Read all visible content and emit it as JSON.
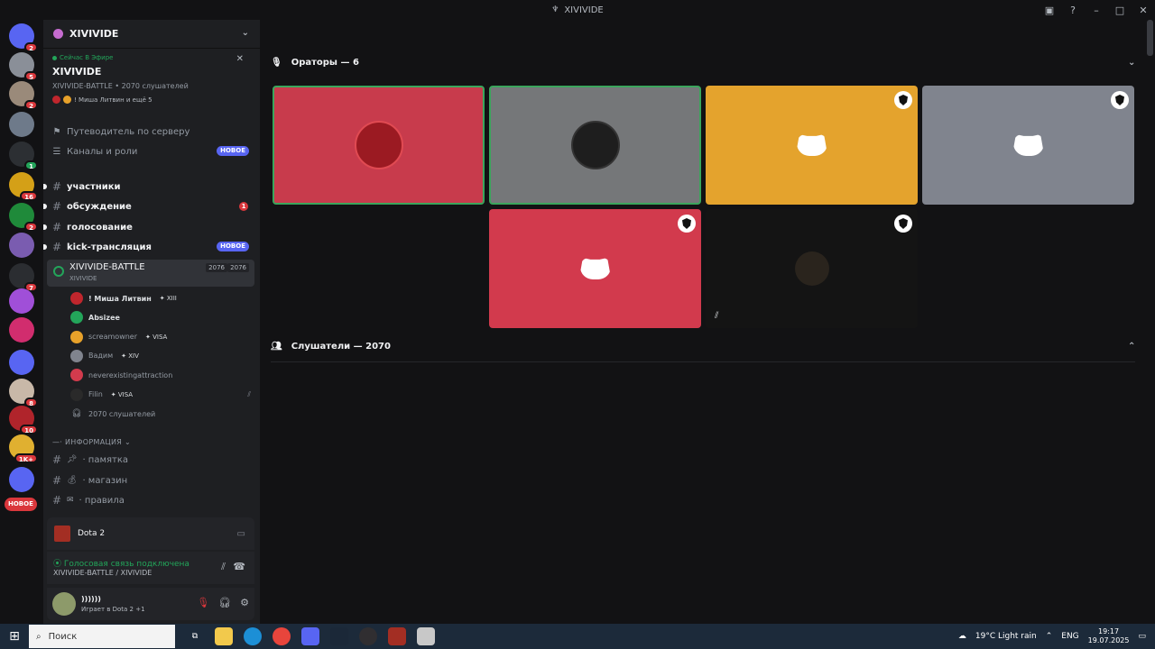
{
  "window": {
    "title": "XIVIVIDE"
  },
  "guilds": {
    "badges": [
      "2",
      "5",
      "2",
      "",
      "1",
      "16",
      "2",
      "",
      "7",
      "",
      "",
      "",
      "8",
      "10",
      "1K+",
      ""
    ],
    "new_label": "НОВОЕ"
  },
  "server": {
    "name": "XIVIVIDE"
  },
  "live": {
    "tag": "Сейчас В Эфире",
    "name": "XIVIVIDE",
    "meta": "XIVIVIDE-BATTLE • 2070 слушателей",
    "who": "! Миша Литвин и ещё 5"
  },
  "nav": {
    "guide": "Путеводитель по серверу",
    "channels_roles": "Каналы и роли",
    "new_badge": "НОВОЕ"
  },
  "channels": [
    {
      "name": "участники",
      "badge": ""
    },
    {
      "name": "обсуждение",
      "badge": "1"
    },
    {
      "name": "голосование",
      "badge": ""
    },
    {
      "name": "kick-трансляция",
      "badge": "НОВОЕ"
    }
  ],
  "voice_channel": {
    "name": "XIVIVIDE-BATTLE",
    "sub": "XIVIVIDE",
    "count1": "2076",
    "count2": "2076"
  },
  "voice_users": [
    {
      "name": "! Миша Литвин",
      "tag": "XIII",
      "color": "#c0262d"
    },
    {
      "name": "Absizee",
      "tag": "",
      "color": "#23a55a"
    },
    {
      "name": "screamowner",
      "tag": "VISA",
      "color": "#e7a12a"
    },
    {
      "name": "Вадим",
      "tag": "XIV",
      "color": "#80848e"
    },
    {
      "name": "neverexistingattraction",
      "tag": "",
      "color": "#d23b4d"
    },
    {
      "name": "Filin",
      "tag": "VISA",
      "color": "#2a2a2a"
    }
  ],
  "listeners_text": "2070 слушателей",
  "category": "ИНФОРМАЦИЯ",
  "info_channels": [
    "памятка",
    "магазин",
    "правила"
  ],
  "now_playing": "Dota 2",
  "voice_status": {
    "status": "Голосовая связь подключена",
    "channel": "XIVIVIDE-BATTLE / XIVIVIDE"
  },
  "user": {
    "name": "))))))",
    "activity": "Играет в Dota 2 +1"
  },
  "stage": {
    "speakers_label": "Ораторы — 6",
    "listeners_label": "Слушатели — 2070",
    "tiles": [
      {
        "kind": "avatar",
        "bg": "#c83b4c",
        "speaking": true,
        "mod": false
      },
      {
        "kind": "avatar",
        "bg": "#757779",
        "speaking": true,
        "mod": false
      },
      {
        "kind": "discord",
        "bg": "#e4a32d",
        "speaking": false,
        "mod": true
      },
      {
        "kind": "discord",
        "bg": "#80848e",
        "speaking": false,
        "mod": true
      },
      {
        "kind": "discord",
        "bg": "#d23a4d",
        "speaking": false,
        "mod": true
      },
      {
        "kind": "owl",
        "bg": "#141414",
        "speaking": false,
        "mod": true
      }
    ]
  },
  "taskbar": {
    "search_placeholder": "Поиск",
    "weather": "19°C  Light rain",
    "lang": "ENG",
    "time": "19:17",
    "date": "19.07.2025"
  }
}
